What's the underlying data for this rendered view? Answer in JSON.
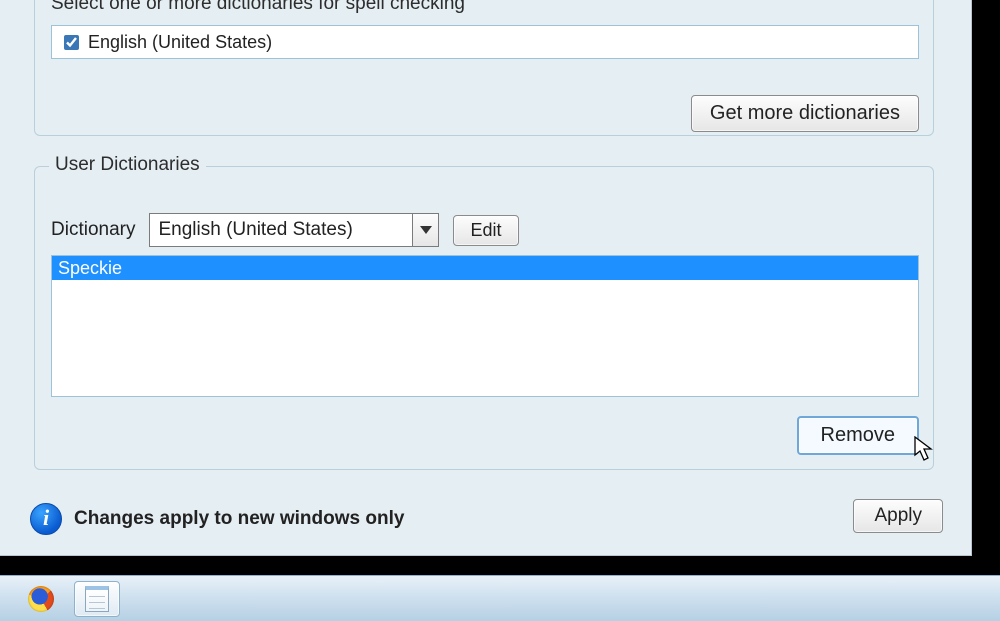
{
  "spellcheck": {
    "instruction": "Select one or more dictionaries for spell checking",
    "dictionaries": [
      {
        "label": "English (United States)",
        "checked": true
      }
    ],
    "get_more_label": "Get more dictionaries"
  },
  "user_dict": {
    "legend": "User Dictionaries",
    "dictionary_label": "Dictionary",
    "selected_dictionary": "English (United States)",
    "edit_label": "Edit",
    "entries": [
      "Speckie"
    ],
    "remove_label": "Remove"
  },
  "footer": {
    "info_text": "Changes apply to new windows only",
    "apply_label": "Apply"
  },
  "taskbar": {
    "items": [
      {
        "name": "firefox",
        "active": false
      },
      {
        "name": "notepad",
        "active": true
      }
    ]
  }
}
